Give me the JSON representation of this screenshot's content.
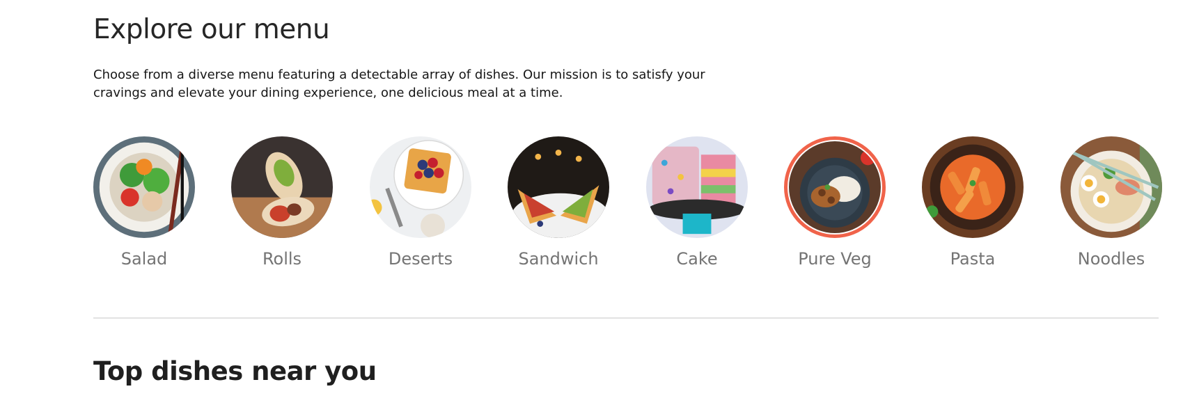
{
  "explore": {
    "title": "Explore our menu",
    "description": "Choose from a diverse menu featuring a detectable array of dishes. Our mission is to satisfy your cravings and elevate your dining experience, one delicious meal at a time."
  },
  "menu": {
    "items": [
      {
        "label": "Salad",
        "icon": "salad-image"
      },
      {
        "label": "Rolls",
        "icon": "rolls-image"
      },
      {
        "label": "Deserts",
        "icon": "deserts-image"
      },
      {
        "label": "Sandwich",
        "icon": "sandwich-image"
      },
      {
        "label": "Cake",
        "icon": "cake-image"
      },
      {
        "label": "Pure Veg",
        "icon": "pure-veg-image",
        "active": true
      },
      {
        "label": "Pasta",
        "icon": "pasta-image"
      },
      {
        "label": "Noodles",
        "icon": "noodles-image"
      }
    ]
  },
  "top_dishes": {
    "title": "Top dishes near you"
  },
  "colors": {
    "accent": "#f0634a",
    "label": "#747474",
    "divider": "#e2e2e2"
  }
}
